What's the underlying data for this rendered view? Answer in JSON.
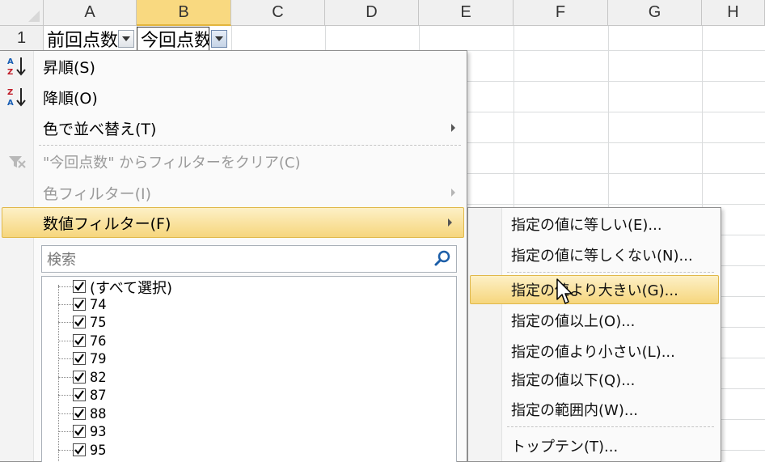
{
  "sheet": {
    "columns": [
      "A",
      "B",
      "C",
      "D",
      "E",
      "F",
      "G",
      "H"
    ],
    "row1_number": "1",
    "cells": {
      "a1": "前回点数",
      "b1": "今回点数"
    }
  },
  "menu": {
    "sort_asc": "昇順(S)",
    "sort_desc": "降順(O)",
    "sort_by_color": "色で並べ替え(T)",
    "clear_filter": "\"今回点数\" からフィルターをクリア(C)",
    "color_filter": "色フィルター(I)",
    "number_filter": "数値フィルター(F)",
    "search_placeholder": "検索",
    "list_items": [
      "(すべて選択)",
      "74",
      "75",
      "76",
      "79",
      "82",
      "87",
      "88",
      "93",
      "95"
    ]
  },
  "submenu": {
    "items": [
      "指定の値に等しい(E)...",
      "指定の値に等しくない(N)...",
      "指定の値より大きい(G)...",
      "指定の値以上(O)...",
      "指定の値より小さい(L)...",
      "指定の値以下(Q)...",
      "指定の範囲内(W)...",
      "トップテン(T)..."
    ]
  },
  "icons": {
    "sort_asc": "sort-az-icon",
    "sort_desc": "sort-za-icon",
    "clear_filter": "clear-filter-icon",
    "search": "magnifier-icon",
    "filter_dropdown": "filter-dropdown-icon",
    "cursor": "mouse-pointer-icon"
  },
  "colors": {
    "highlight": "#f6d67d",
    "selected_header": "#f9d980",
    "disabled_text": "#9a9a9a"
  }
}
